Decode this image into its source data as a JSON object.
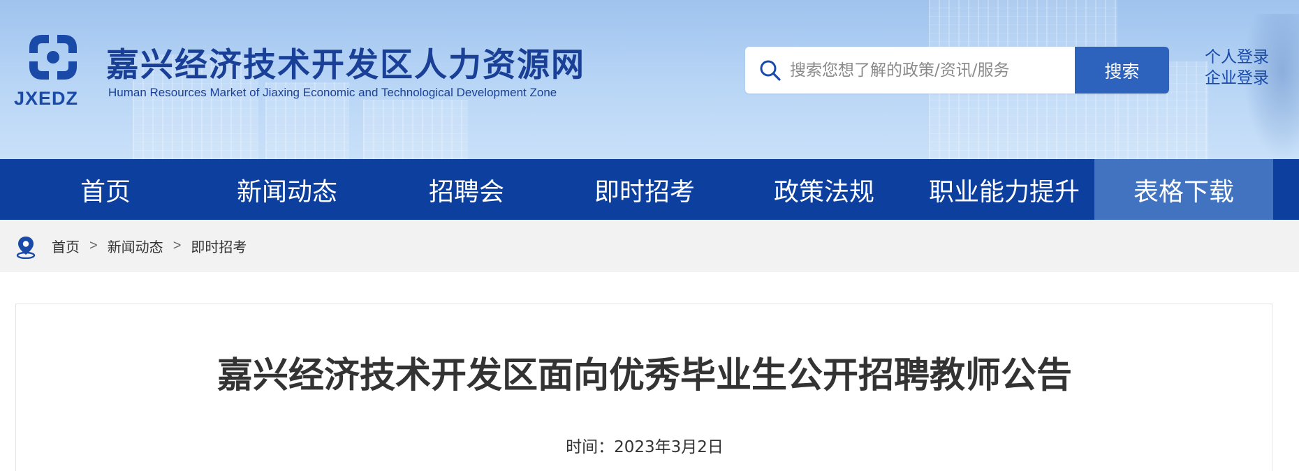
{
  "header": {
    "logo_text": "JXEDZ",
    "site_title": "嘉兴经济技术开发区人力资源网",
    "site_subtitle": "Human Resources Market of Jiaxing Economic and Technological Development Zone",
    "brand_color": "#1a3f96"
  },
  "search": {
    "placeholder": "搜索您想了解的政策/资讯/服务",
    "button_label": "搜索",
    "button_color": "#2d62bd"
  },
  "login": {
    "personal": "个人登录",
    "enterprise": "企业登录"
  },
  "nav": {
    "background": "#0c3f9e",
    "active_background": "#4273c0",
    "items": [
      {
        "label": "首页"
      },
      {
        "label": "新闻动态"
      },
      {
        "label": "招聘会"
      },
      {
        "label": "即时招考"
      },
      {
        "label": "政策法规"
      },
      {
        "label": "职业能力提升"
      },
      {
        "label": "表格下载",
        "active": true
      }
    ]
  },
  "breadcrumb": {
    "icon": "location-pin-icon",
    "items": [
      "首页",
      "新闻动态",
      "即时招考"
    ],
    "separator": ">"
  },
  "article": {
    "title": "嘉兴经济技术开发区面向优秀毕业生公开招聘教师公告",
    "date": "时间：2023年3月2日"
  }
}
